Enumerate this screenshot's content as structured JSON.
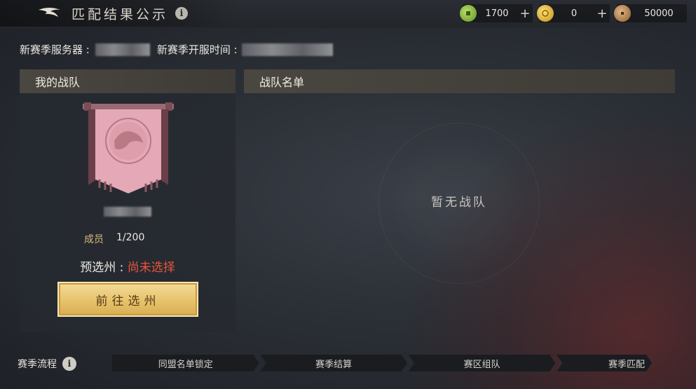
{
  "header": {
    "title": "匹配结果公示",
    "info_glyph": "i",
    "back_icon": "back-arrow-icon"
  },
  "currencies": [
    {
      "icon": "jade-coin-icon",
      "value": "1700",
      "plus": "+",
      "color": "#7fb33a"
    },
    {
      "icon": "gold-coin-icon",
      "value": "0",
      "plus": "+",
      "color": "#e2b52a"
    },
    {
      "icon": "copper-coin-icon",
      "value": "50000",
      "color": "#b8895a"
    }
  ],
  "server": {
    "server_label": "新赛季服务器 :",
    "open_time_label": "新赛季开服时间 :"
  },
  "my_team": {
    "heading": "我的战队",
    "member_label": "成员",
    "member_value": "1/200",
    "state_label": "预选州 : ",
    "state_value": "尚未选择",
    "go_button": "前往选州",
    "banner_color": "#e4a8b6"
  },
  "roster": {
    "heading": "战队名单",
    "empty_text": "暂无战队"
  },
  "season_flow": {
    "label": "赛季流程",
    "steps": [
      "同盟名单锁定",
      "赛季结算",
      "赛区组队",
      "赛季匹配"
    ]
  }
}
